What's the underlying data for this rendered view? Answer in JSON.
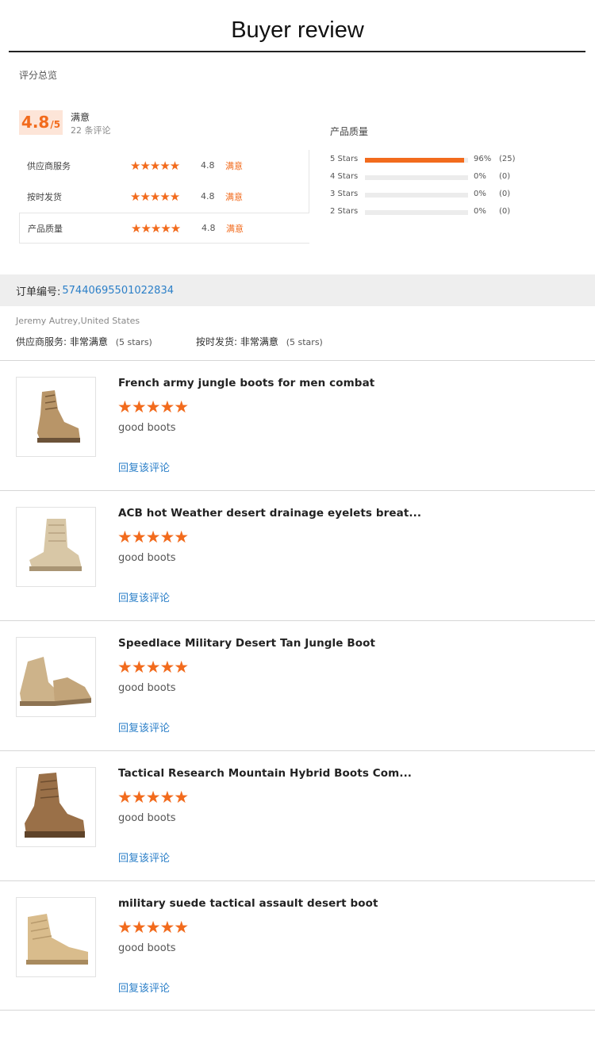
{
  "page": {
    "title": "Buyer review"
  },
  "overview": {
    "label": "评分总览",
    "score": "4.8",
    "score_suffix": "/5",
    "verdict": "满意",
    "review_count": "22 条评论"
  },
  "ratings": [
    {
      "label": "供应商服务",
      "stars": "★★★★★",
      "score": "4.8",
      "verdict": "满意"
    },
    {
      "label": "按时发货",
      "stars": "★★★★★",
      "score": "4.8",
      "verdict": "满意"
    },
    {
      "label": "产品质量",
      "stars": "★★★★★",
      "score": "4.8",
      "verdict": "满意"
    }
  ],
  "quality": {
    "title": "产品质量",
    "rows": [
      {
        "label": "5 Stars",
        "percent": "96%",
        "count": "(25)",
        "fill": 0.96
      },
      {
        "label": "4 Stars",
        "percent": "0%",
        "count": "(0)",
        "fill": 0
      },
      {
        "label": "3 Stars",
        "percent": "0%",
        "count": "(0)",
        "fill": 0
      },
      {
        "label": "2 Stars",
        "percent": "0%",
        "count": "(0)",
        "fill": 0
      }
    ]
  },
  "order": {
    "label": "订单编号:",
    "number": "57440695501022834"
  },
  "buyer": {
    "name": "Jeremy Autrey,United States",
    "supplier_label": "供应商服务:",
    "supplier_value": "非常满意",
    "supplier_stars": "(5 stars)",
    "shipping_label": "按时发货:",
    "shipping_value": "非常满意",
    "shipping_stars": "(5 stars)"
  },
  "reviews": [
    {
      "title": "French army jungle boots for men combat",
      "stars": "★★★★★",
      "text": "good boots",
      "reply": "回复该评论"
    },
    {
      "title": "ACB hot Weather desert drainage eyelets breat...",
      "stars": "★★★★★",
      "text": "good boots",
      "reply": "回复该评论"
    },
    {
      "title": "Speedlace Military Desert Tan Jungle Boot",
      "stars": "★★★★★",
      "text": "good boots",
      "reply": "回复该评论"
    },
    {
      "title": "Tactical Research Mountain Hybrid Boots Com...",
      "stars": "★★★★★",
      "text": "good boots",
      "reply": "回复该评论"
    },
    {
      "title": "military suede tactical assault desert boot",
      "stars": "★★★★★",
      "text": "good boots",
      "reply": "回复该评论"
    }
  ],
  "colors": {
    "accent": "#f26b1d",
    "link": "#2b7fc8",
    "boot_tan": "#c9a678"
  }
}
